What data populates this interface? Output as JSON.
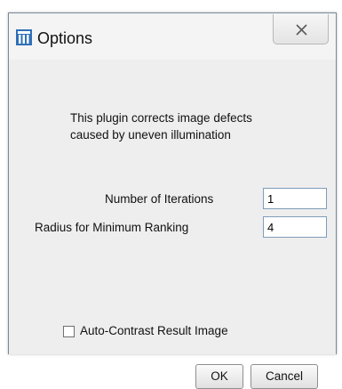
{
  "window": {
    "title": "Options",
    "app_icon": "imagej-icon",
    "close_icon": "close-x-icon"
  },
  "dialog": {
    "description_line1": "This plugin corrects image defects",
    "description_line2": "caused by uneven illumination",
    "iterations_label": "Number of Iterations",
    "iterations_value": "1",
    "radius_label": "Radius for Minimum Ranking",
    "radius_value": "4",
    "autocontrast_label": "Auto-Contrast Result Image",
    "autocontrast_checked": false
  },
  "buttons": {
    "ok": "OK",
    "cancel": "Cancel"
  }
}
